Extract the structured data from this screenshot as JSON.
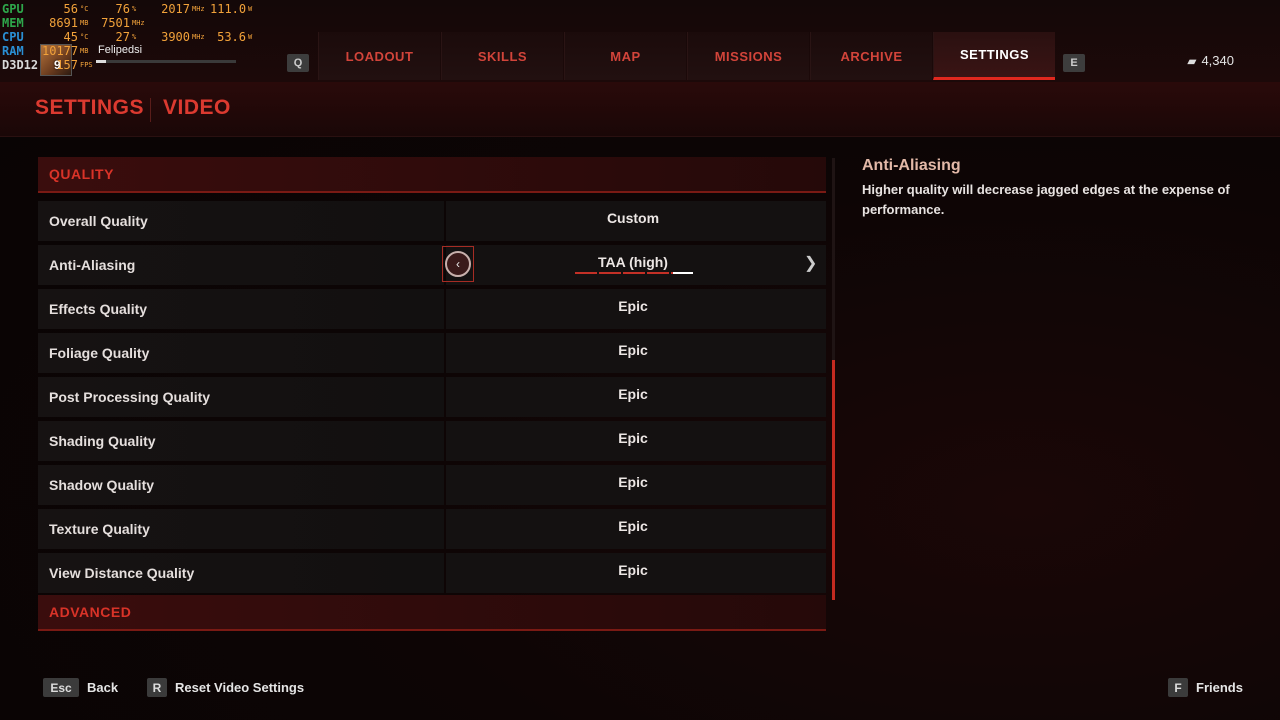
{
  "overlay": {
    "rows": [
      {
        "label": "GPU",
        "v1": "56",
        "u1": "°C",
        "v2": "76",
        "u2": "%",
        "v3": "2017",
        "u3": "MHz",
        "v4": "111.0",
        "u4": "W"
      },
      {
        "label": "MEM",
        "v1": "8691",
        "u1": "MB",
        "v2": "7501",
        "u2": "MHz",
        "v3": "",
        "u3": "",
        "v4": "",
        "u4": ""
      },
      {
        "label": "CPU",
        "v1": "45",
        "u1": "°C",
        "v2": "27",
        "u2": "%",
        "v3": "3900",
        "u3": "MHz",
        "v4": "53.6",
        "u4": "W"
      },
      {
        "label": "RAM",
        "v1": "10177",
        "u1": "MB",
        "v2": "",
        "u2": "",
        "v3": "",
        "u3": "",
        "v4": "",
        "u4": ""
      },
      {
        "label": "D3D12",
        "v1": "157",
        "u1": "FPS",
        "v2": "",
        "u2": "",
        "v3": "",
        "u3": "",
        "v4": "",
        "u4": ""
      }
    ]
  },
  "player": {
    "name": "Felipedsi",
    "level": "9",
    "xp_fraction": 0.07
  },
  "nav": {
    "prev_key": "Q",
    "next_key": "E",
    "tabs": [
      "LOADOUT",
      "SKILLS",
      "MAP",
      "MISSIONS",
      "ARCHIVE",
      "SETTINGS"
    ],
    "active_tab": "SETTINGS",
    "currency": "4,340"
  },
  "header": {
    "section": "SETTINGS",
    "page": "VIDEO"
  },
  "settings": {
    "quality_header": "QUALITY",
    "advanced_header": "ADVANCED",
    "rows": [
      {
        "label": "Overall Quality",
        "value": "Custom"
      },
      {
        "label": "Anti-Aliasing",
        "value": "TAA (high)"
      },
      {
        "label": "Effects Quality",
        "value": "Epic"
      },
      {
        "label": "Foliage Quality",
        "value": "Epic"
      },
      {
        "label": "Post Processing Quality",
        "value": "Epic"
      },
      {
        "label": "Shading Quality",
        "value": "Epic"
      },
      {
        "label": "Shadow Quality",
        "value": "Epic"
      },
      {
        "label": "Texture Quality",
        "value": "Epic"
      },
      {
        "label": "View Distance Quality",
        "value": "Epic"
      }
    ],
    "aa_level": {
      "selected": 5,
      "total": 5
    }
  },
  "description": {
    "title": "Anti-Aliasing",
    "body": "Higher quality will decrease jagged edges at the expense of performance."
  },
  "footer": {
    "back_key": "Esc",
    "back_label": "Back",
    "reset_key": "R",
    "reset_label": "Reset Video Settings",
    "friends_key": "F",
    "friends_label": "Friends"
  },
  "colors": {
    "accent": "#dc3a30",
    "active_underline": "#e0281e",
    "background": "#0d0505"
  }
}
